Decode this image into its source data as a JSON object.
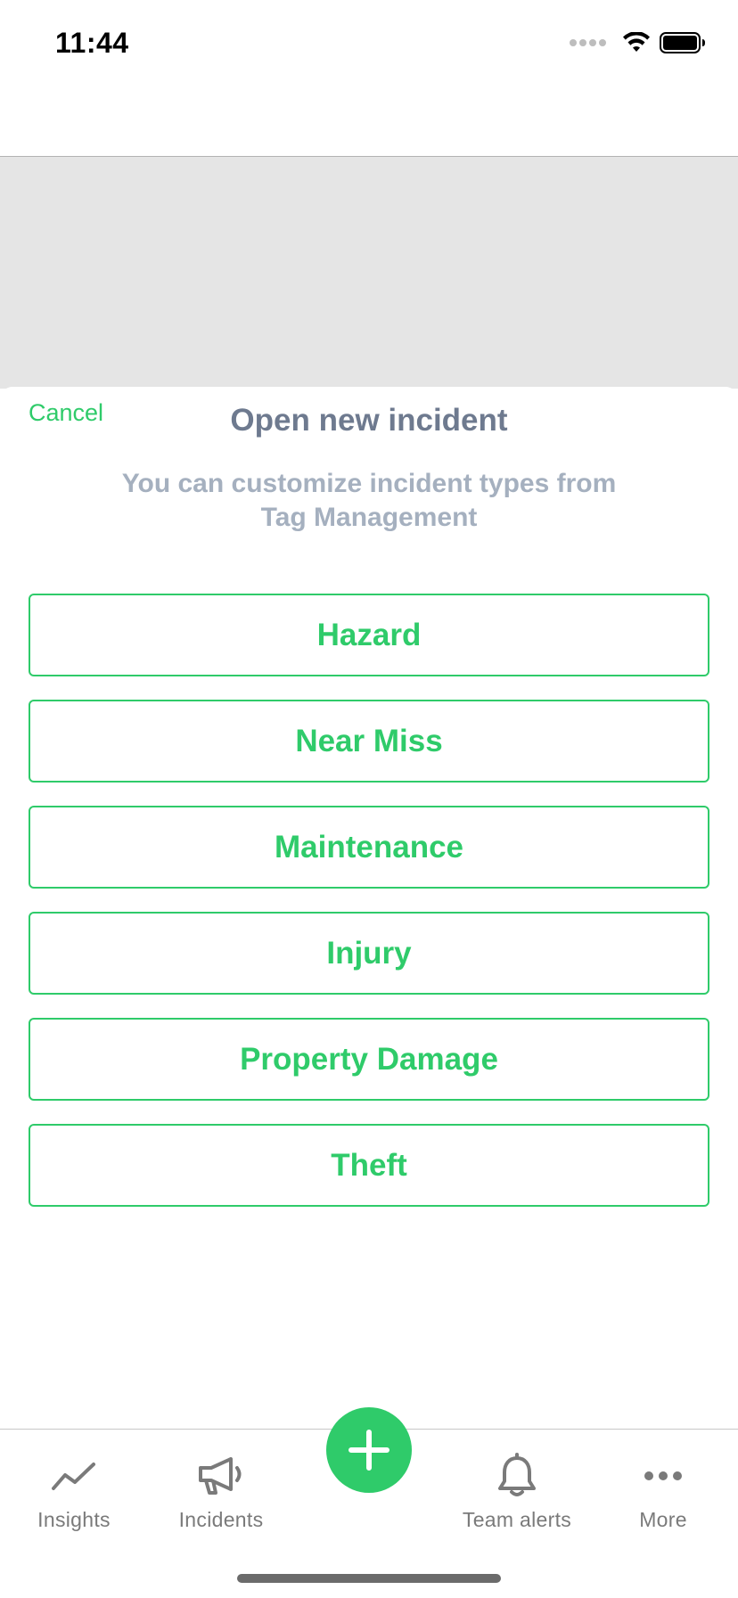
{
  "status_bar": {
    "time": "11:44"
  },
  "sheet": {
    "cancel_label": "Cancel",
    "title": "Open new incident",
    "subtitle_line1": "You can customize incident types from",
    "subtitle_line2": "Tag Management"
  },
  "incident_types": [
    {
      "label": "Hazard"
    },
    {
      "label": "Near Miss"
    },
    {
      "label": "Maintenance"
    },
    {
      "label": "Injury"
    },
    {
      "label": "Property Damage"
    },
    {
      "label": "Theft"
    }
  ],
  "tab_bar": {
    "tabs": [
      {
        "label": "Insights",
        "icon": "trend-line-icon"
      },
      {
        "label": "Incidents",
        "icon": "megaphone-icon"
      },
      {
        "label": "Team alerts",
        "icon": "bell-icon"
      },
      {
        "label": "More",
        "icon": "ellipsis-icon"
      }
    ],
    "fab_icon": "plus-icon"
  },
  "colors": {
    "accent": "#2fcb6a",
    "title": "#6e7a8f",
    "subtitle": "#a5b0bf",
    "dim_overlay": "#e5e5e5",
    "tab_label": "#7a7a7a"
  }
}
